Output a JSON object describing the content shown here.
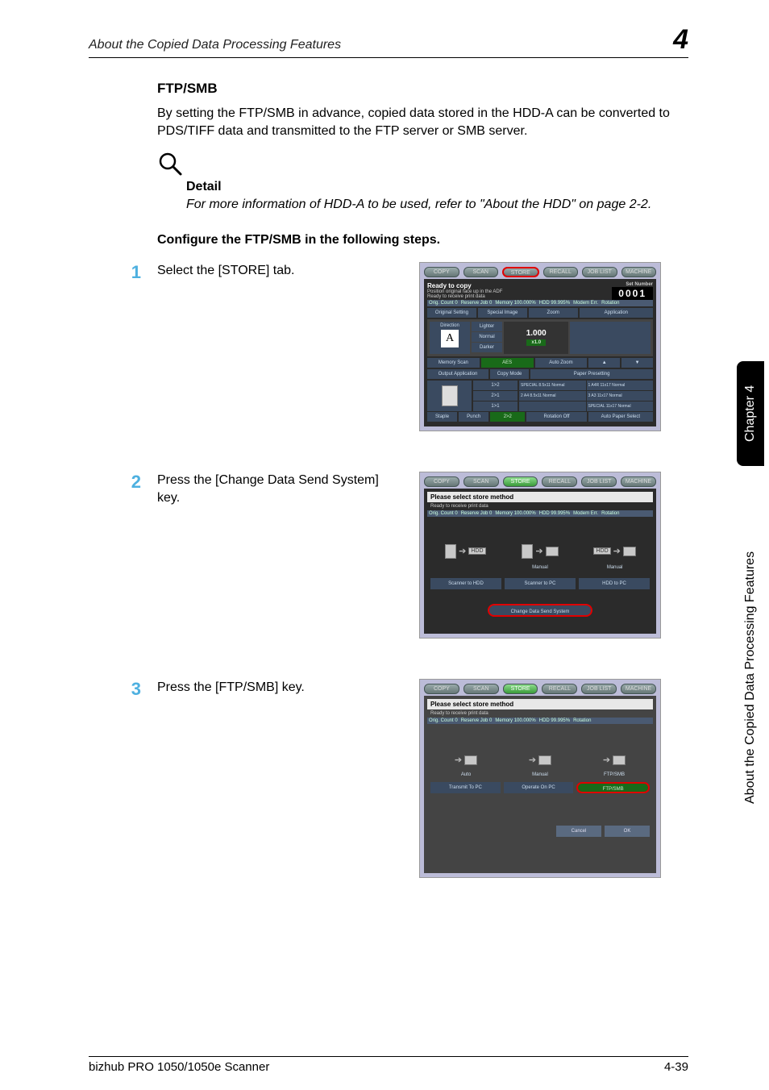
{
  "header": {
    "title": "About the Copied Data Processing Features",
    "chapter_num": "4"
  },
  "sections": {
    "ftpsmb_title": "FTP/SMB",
    "ftpsmb_para": "By setting the FTP/SMB in advance, copied data stored in the HDD-A can be converted to PDS/TIFF data and transmitted to the FTP server or SMB server.",
    "detail_label": "Detail",
    "detail_text": "For more information of HDD-A to be used, refer to \"About the HDD\" on page 2-2.",
    "configure": "Configure the FTP/SMB in the following steps."
  },
  "steps": [
    {
      "num": "1",
      "text": "Select the [STORE] tab."
    },
    {
      "num": "2",
      "text": "Press the [Change Data Send System] key."
    },
    {
      "num": "3",
      "text": "Press the [FTP/SMB] key."
    }
  ],
  "screenshot1": {
    "tabs": [
      "COPY",
      "SCAN",
      "STORE",
      "RECALL",
      "JOB LIST",
      "MACHINE"
    ],
    "ready": "Ready to copy",
    "ready_sub1": "Position original face up in the ADF",
    "ready_sub2": "Ready to receive print data",
    "set_number_label": "Set Number",
    "set_number": "0001",
    "infobar": [
      "Orig. Count   0",
      "Reserve Job   0",
      "Memory 100.000%",
      "HDD     99.995%",
      "Modem Err.",
      "Rotation"
    ],
    "row4": [
      "Original Setting",
      "Special Image",
      "Zoom",
      "Application"
    ],
    "direction": "Direction",
    "direction_icon": "A",
    "density": [
      "Lighter",
      "Normal",
      "Darker"
    ],
    "zoom_val": "1.000",
    "zoom_sub": "x1.0",
    "memory_scan": "Memory Scan",
    "aes": "AES",
    "auto_zoom": "Auto Zoom",
    "output_app": "Output Application",
    "copy_mode": "Copy Mode",
    "paper_presetting": "Paper Presetting",
    "copy_modes": [
      "1>2",
      "2>1",
      "1>1",
      "2>2"
    ],
    "paper_rows": [
      [
        "SPECIAL 8.5x11 Normal",
        "1  A4R 11x17 Normal"
      ],
      [
        "2  A4  8.5x11 Normal",
        "3  A3  11x17 Normal"
      ],
      [
        "",
        "SPECIAL 11x17 Normal"
      ]
    ],
    "staple": "Staple",
    "punch": "Punch",
    "rotation_off": "Rotation Off",
    "auto_paper": "Auto Paper Select"
  },
  "screenshot2": {
    "tabs": [
      "COPY",
      "SCAN",
      "STORE",
      "RECALL",
      "JOB LIST",
      "MACHINE"
    ],
    "title": "Please select store method",
    "sub": "Ready to receive print data",
    "infobar": [
      "Orig. Count   0",
      "Reserve Job   0",
      "Memory 100.000%",
      "HDD     99.995%",
      "Modem Err.",
      "Rotation"
    ],
    "cells": [
      {
        "icon_to": "HDD",
        "label": ""
      },
      {
        "icon_to": "PC",
        "label": "Manual"
      },
      {
        "icon_from": "HDD",
        "icon_to": "PC",
        "label": "Manual"
      }
    ],
    "buttons": [
      "Scanner to HDD",
      "Scanner to PC",
      "HDD to PC"
    ],
    "change": "Change Data Send System"
  },
  "screenshot3": {
    "tabs": [
      "COPY",
      "SCAN",
      "STORE",
      "RECALL",
      "JOB LIST",
      "MACHINE"
    ],
    "title": "Please select store method",
    "sub": "Ready to receive print data",
    "infobar": [
      "Orig. Count   0",
      "Reserve Job   0",
      "Memory 100.000%",
      "HDD     99.995%",
      "Rotation"
    ],
    "cells": [
      {
        "label": "Auto"
      },
      {
        "label": "Manual"
      },
      {
        "label": "FTP/SMB"
      }
    ],
    "buttons": [
      "Transmit To PC",
      "Operate On PC",
      "FTP/SMB"
    ],
    "bottom": [
      "Cancel",
      "OK"
    ]
  },
  "sidebar": {
    "chapter": "Chapter 4",
    "title": "About the Copied Data Processing Features"
  },
  "footer": {
    "left": "bizhub PRO 1050/1050e Scanner",
    "right": "4-39"
  }
}
